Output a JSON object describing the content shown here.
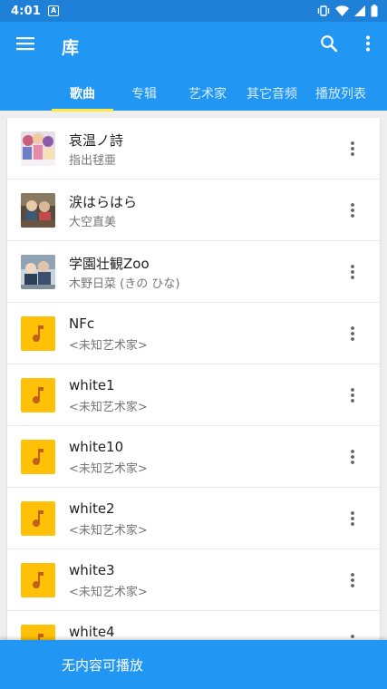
{
  "status_bar": {
    "time": "4:01",
    "notification_letter": "A"
  },
  "app_bar": {
    "title": "库"
  },
  "tabs": [
    {
      "label": "歌曲",
      "active": true
    },
    {
      "label": "专辑",
      "active": false
    },
    {
      "label": "艺术家",
      "active": false
    },
    {
      "label": "其它音频",
      "active": false
    },
    {
      "label": "播放列表",
      "active": false
    }
  ],
  "songs": [
    {
      "title": "哀温ノ詩",
      "artist": "指出毬亜",
      "art": "album-cover-1"
    },
    {
      "title": "涙はらはら",
      "artist": "大空直美",
      "art": "album-cover-2"
    },
    {
      "title": "学園壮観Zoo",
      "artist": "木野日菜 (きの ひな)",
      "art": "album-cover-3"
    },
    {
      "title": "NFc",
      "artist": "<未知艺术家>",
      "art": "music-note-icon"
    },
    {
      "title": "white1",
      "artist": "<未知艺术家>",
      "art": "music-note-icon"
    },
    {
      "title": "white10",
      "artist": "<未知艺术家>",
      "art": "music-note-icon"
    },
    {
      "title": "white2",
      "artist": "<未知艺术家>",
      "art": "music-note-icon"
    },
    {
      "title": "white3",
      "artist": "<未知艺术家>",
      "art": "music-note-icon"
    },
    {
      "title": "white4",
      "artist": "",
      "art": "music-note-icon"
    }
  ],
  "player_bar": {
    "text": "无内容可播放"
  },
  "colors": {
    "primary": "#2196f3",
    "status_bar": "#1f80d7",
    "tab_indicator": "#ffeb3b",
    "placeholder_art": "#ffc107",
    "note_color": "#c1621c"
  }
}
